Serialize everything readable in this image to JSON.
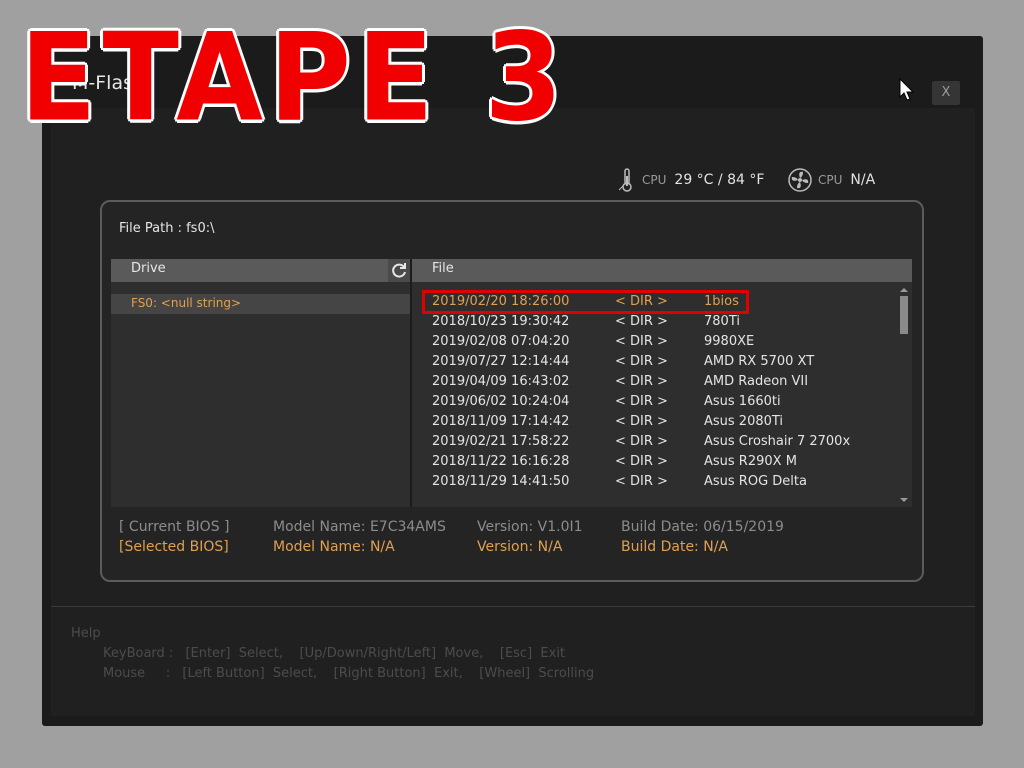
{
  "window": {
    "title": "M-Flash",
    "close_label": "X"
  },
  "overlay": {
    "text": "ETAPE 3"
  },
  "sensors": {
    "cpu_temp": {
      "label": "CPU",
      "value": "29 °C / 84 °F"
    },
    "cpu_fan": {
      "label": "CPU",
      "value": "N/A"
    }
  },
  "file_path": {
    "label": "File Path :",
    "value": "fs0:\\"
  },
  "drive_panel": {
    "header": "Drive",
    "items": [
      "FS0: <null string>"
    ]
  },
  "file_panel": {
    "header": "File",
    "rows": [
      {
        "date": "2019/02/20 18:26:00",
        "type": "< DIR >",
        "name": "1bios"
      },
      {
        "date": "2018/10/23 19:30:42",
        "type": "< DIR >",
        "name": "780Ti"
      },
      {
        "date": "2019/02/08 07:04:20",
        "type": "< DIR >",
        "name": "9980XE"
      },
      {
        "date": "2019/07/27 12:14:44",
        "type": "< DIR >",
        "name": "AMD RX 5700 XT"
      },
      {
        "date": "2019/04/09 16:43:02",
        "type": "< DIR >",
        "name": "AMD Radeon VII"
      },
      {
        "date": "2019/06/02 10:24:04",
        "type": "< DIR >",
        "name": "Asus 1660ti"
      },
      {
        "date": "2018/11/09 17:14:42",
        "type": "< DIR >",
        "name": "Asus 2080Ti"
      },
      {
        "date": "2019/02/21 17:58:22",
        "type": "< DIR >",
        "name": "Asus Croshair 7 2700x"
      },
      {
        "date": "2018/11/22 16:16:28",
        "type": "< DIR >",
        "name": "Asus R290X M"
      },
      {
        "date": "2018/11/29 14:41:50",
        "type": "< DIR >",
        "name": "Asus ROG Delta"
      }
    ]
  },
  "bios": {
    "current": {
      "label": "[ Current BIOS  ]",
      "model": "Model Name: E7C34AMS",
      "version": "Version: V1.0I1",
      "date": "Build Date: 06/15/2019"
    },
    "selected": {
      "label": "[Selected BIOS]",
      "model": "Model Name: N/A",
      "version": "Version: N/A",
      "date": "Build Date: N/A"
    }
  },
  "help": {
    "title": "Help",
    "keyboard_label": "KeyBoard :",
    "keyboard_text": "[Enter]  Select,    [Up/Down/Right/Left]  Move,    [Esc]  Exit",
    "mouse_label": "Mouse     :",
    "mouse_text": "[Left Button]  Select,    [Right Button]  Exit,    [Wheel]  Scrolling"
  },
  "colors": {
    "accent": "#e0a050",
    "highlight_box": "#e00000",
    "overlay_text": "#f00000"
  }
}
